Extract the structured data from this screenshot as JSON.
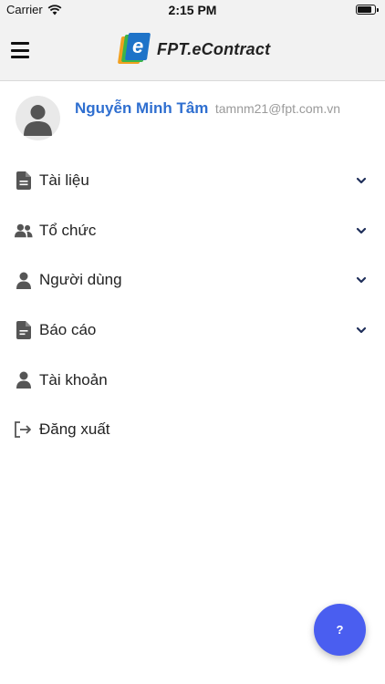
{
  "status_bar": {
    "carrier": "Carrier",
    "time": "2:15 PM",
    "battery_level": 0.9
  },
  "header": {
    "logo_letter": "e",
    "logo_text": "FPT.eContract",
    "menu_icon": "hamburger-icon"
  },
  "profile": {
    "name": "Nguyễn Minh Tâm",
    "email": "tamnm21@fpt.com.vn",
    "avatar_icon": "user-avatar-icon"
  },
  "menu": {
    "items": [
      {
        "label": "Tài liệu",
        "icon": "document-icon",
        "expandable": true
      },
      {
        "label": "Tổ chức",
        "icon": "users-icon",
        "expandable": true
      },
      {
        "label": "Người dùng",
        "icon": "user-icon",
        "expandable": true
      },
      {
        "label": "Báo cáo",
        "icon": "report-icon",
        "expandable": true
      },
      {
        "label": "Tài khoản",
        "icon": "user-icon",
        "expandable": false
      },
      {
        "label": "Đăng xuất",
        "icon": "logout-icon",
        "expandable": false
      }
    ]
  },
  "help_button": {
    "label": "?"
  },
  "colors": {
    "accent_blue": "#2f6fd0",
    "fab_blue": "#4a5ef0",
    "icon_gray": "#555555",
    "chevron_navy": "#1f2f5a"
  }
}
